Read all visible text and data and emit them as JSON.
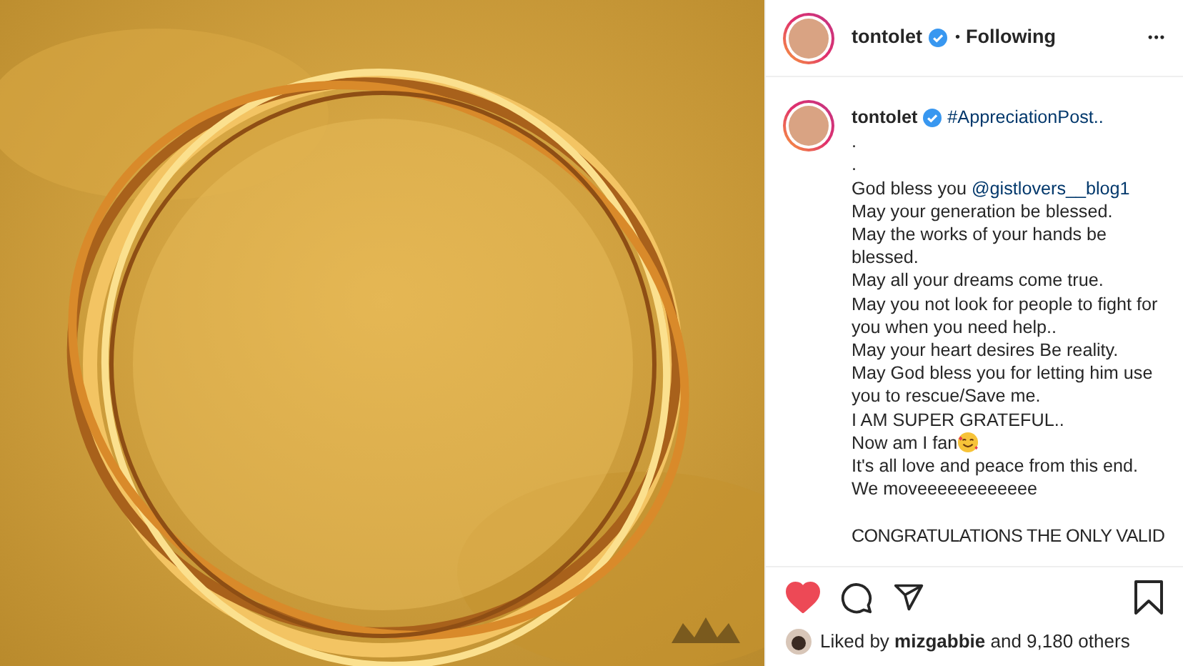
{
  "header": {
    "username": "tontolet",
    "verified": true,
    "separator": "•",
    "follow_status": "Following",
    "more": "•••"
  },
  "caption": {
    "username": "tontolet",
    "verified": true,
    "first_line": "#AppreciationPost..",
    "lines": [
      {
        "text": ".",
        "kind": "text"
      },
      {
        "text": ".",
        "kind": "text"
      },
      {
        "text": "God bless you ",
        "mention": "@gistlovers__blog1",
        "kind": "mention"
      },
      {
        "text": "May your generation be blessed.",
        "kind": "text"
      },
      {
        "text": "May the works of your hands be blessed.",
        "kind": "text"
      },
      {
        "text": "May all your dreams come true.",
        "kind": "text"
      },
      {
        "text": "May you not look for people to fight for you when you need help..",
        "kind": "text"
      },
      {
        "text": "May your heart desires Be reality.",
        "kind": "text"
      },
      {
        "text": "May God bless you for letting him use you to rescue/Save me.",
        "kind": "text"
      },
      {
        "text": "I AM SUPER GRATEFUL..",
        "kind": "text"
      },
      {
        "text": "Now am I fan",
        "kind": "emoji"
      },
      {
        "text": "It's all love and peace from this end.",
        "kind": "text"
      },
      {
        "text": "We moveeeeeeeeeeee",
        "kind": "text"
      },
      {
        "text": "CONGRATULATIONS THE ONLY VALID",
        "kind": "break"
      }
    ]
  },
  "actions": {
    "liked": true,
    "saved": false
  },
  "likes": {
    "prefix": "Liked by ",
    "user": "mizgabbie",
    "suffix": " and 9,180 others"
  }
}
